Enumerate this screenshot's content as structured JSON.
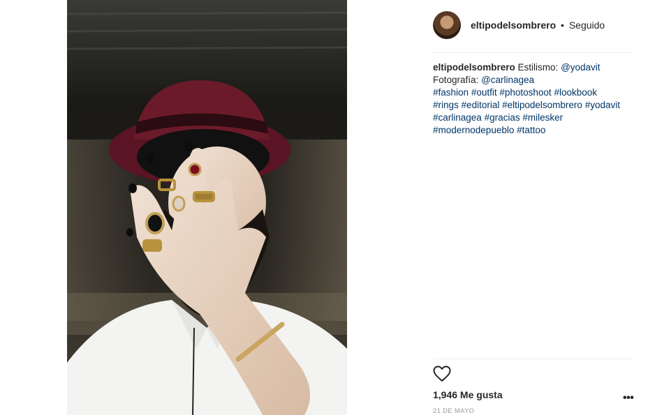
{
  "post": {
    "username": "eltipodelsombrero",
    "separator": "•",
    "follow_status": "Seguido",
    "caption": {
      "user": "eltipodelsombrero",
      "line1_text": "Estilismo:",
      "line1_mention": "@yodavit",
      "line2_text": "Fotografía:",
      "line2_mention": "@carlinagea",
      "line3": [
        "#fashion",
        "#outfit",
        "#photoshoot",
        "#lookbook"
      ],
      "line4": [
        "#rings",
        "#editorial",
        "#eltipodelsombrero",
        "#yodavit"
      ],
      "line5": [
        "#carlinagea",
        "#gracias",
        "#milesker"
      ],
      "line6": [
        "#modernodepueblo",
        "#tattoo"
      ]
    },
    "likes": "1,946 Me gusta",
    "date": "21 DE MAYO",
    "more_label": "•••",
    "image_alt": "Man in burgundy hat covering face with ringed hand"
  },
  "icons": {
    "like": "heart-icon",
    "more": "more-options-icon"
  },
  "colors": {
    "hashtag": "#003569",
    "text": "#262626",
    "muted": "#999999",
    "divider": "#efefef",
    "hat": "#6b1a2a"
  }
}
